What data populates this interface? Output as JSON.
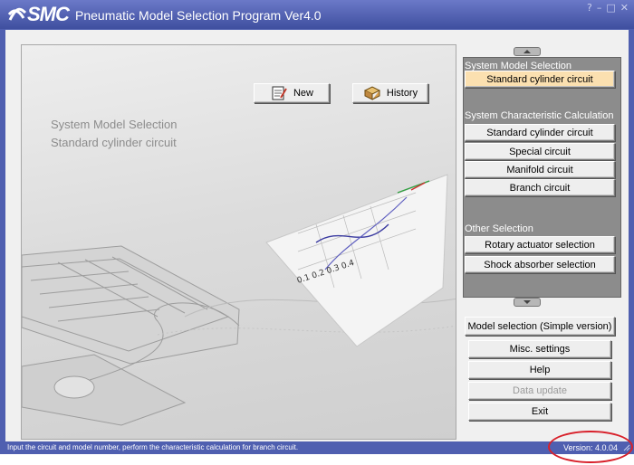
{
  "window": {
    "brand": "SMC",
    "title": "Pneumatic Model Selection Program Ver4.0",
    "controls": [
      "?",
      "–",
      "□",
      "✕"
    ]
  },
  "stage": {
    "buttons": {
      "new": "New",
      "history": "History"
    },
    "heading": "System Model Selection",
    "subheading": "Standard cylinder circuit"
  },
  "panel": {
    "system_model_selection": {
      "label": "System Model Selection",
      "items": [
        "Standard cylinder circuit"
      ]
    },
    "characteristic_calculation": {
      "label": "System Characteristic Calculation",
      "items": [
        "Standard cylinder circuit",
        "Special circuit",
        "Manifold circuit",
        "Branch circuit"
      ]
    },
    "other_selection": {
      "label": "Other Selection",
      "items": [
        "Rotary actuator selection",
        "Shock absorber selection"
      ]
    }
  },
  "actions": {
    "model_selection_simple": "Model selection (Simple version)",
    "misc_settings": "Misc. settings",
    "help": "Help",
    "data_update": "Data update",
    "exit": "Exit"
  },
  "statusbar": {
    "message": "Input the circuit and model number, perform the characteristic calculation for branch circuit.",
    "version": "Version: 4.0.04"
  },
  "colors": {
    "titlebar": "#4f5fb0",
    "selected_button": "#fbe0b0",
    "panel": "#8c8c8c",
    "annotation": "#d8202a"
  }
}
